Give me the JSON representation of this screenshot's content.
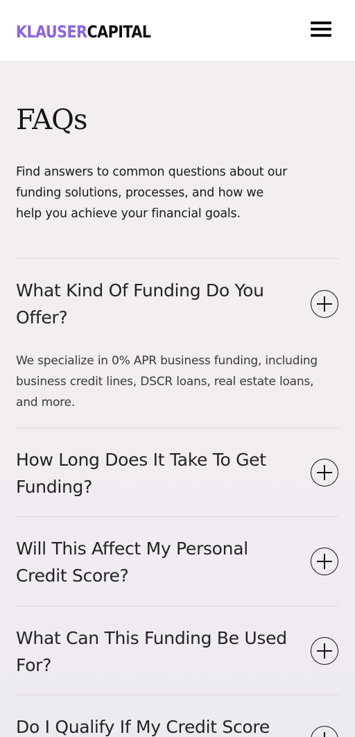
{
  "header": {
    "logo_part1": "KLAUSER",
    "logo_part2": "CAPITAL",
    "menu_icon": "hamburger-menu-icon",
    "colors": {
      "logo_accent": "#8a63e6",
      "logo_dark": "#111111"
    }
  },
  "main": {
    "title": "FAQs",
    "intro": "Find answers to common questions about our funding solutions, processes, and how we help you achieve your financial goals."
  },
  "faqs": [
    {
      "question": "What Kind Of Funding Do You Offer?",
      "answer": "We specialize in 0% APR business funding, including business credit lines, DSCR loans, real estate loans, and more.",
      "expanded": true
    },
    {
      "question": "How Long Does It Take To Get Funding?",
      "expanded": false
    },
    {
      "question": "Will This Affect My Personal Credit Score?",
      "expanded": false
    },
    {
      "question": "What Can This Funding Be Used For?",
      "expanded": false
    },
    {
      "question": "Do I Qualify If My Credit Score",
      "expanded": false
    }
  ]
}
